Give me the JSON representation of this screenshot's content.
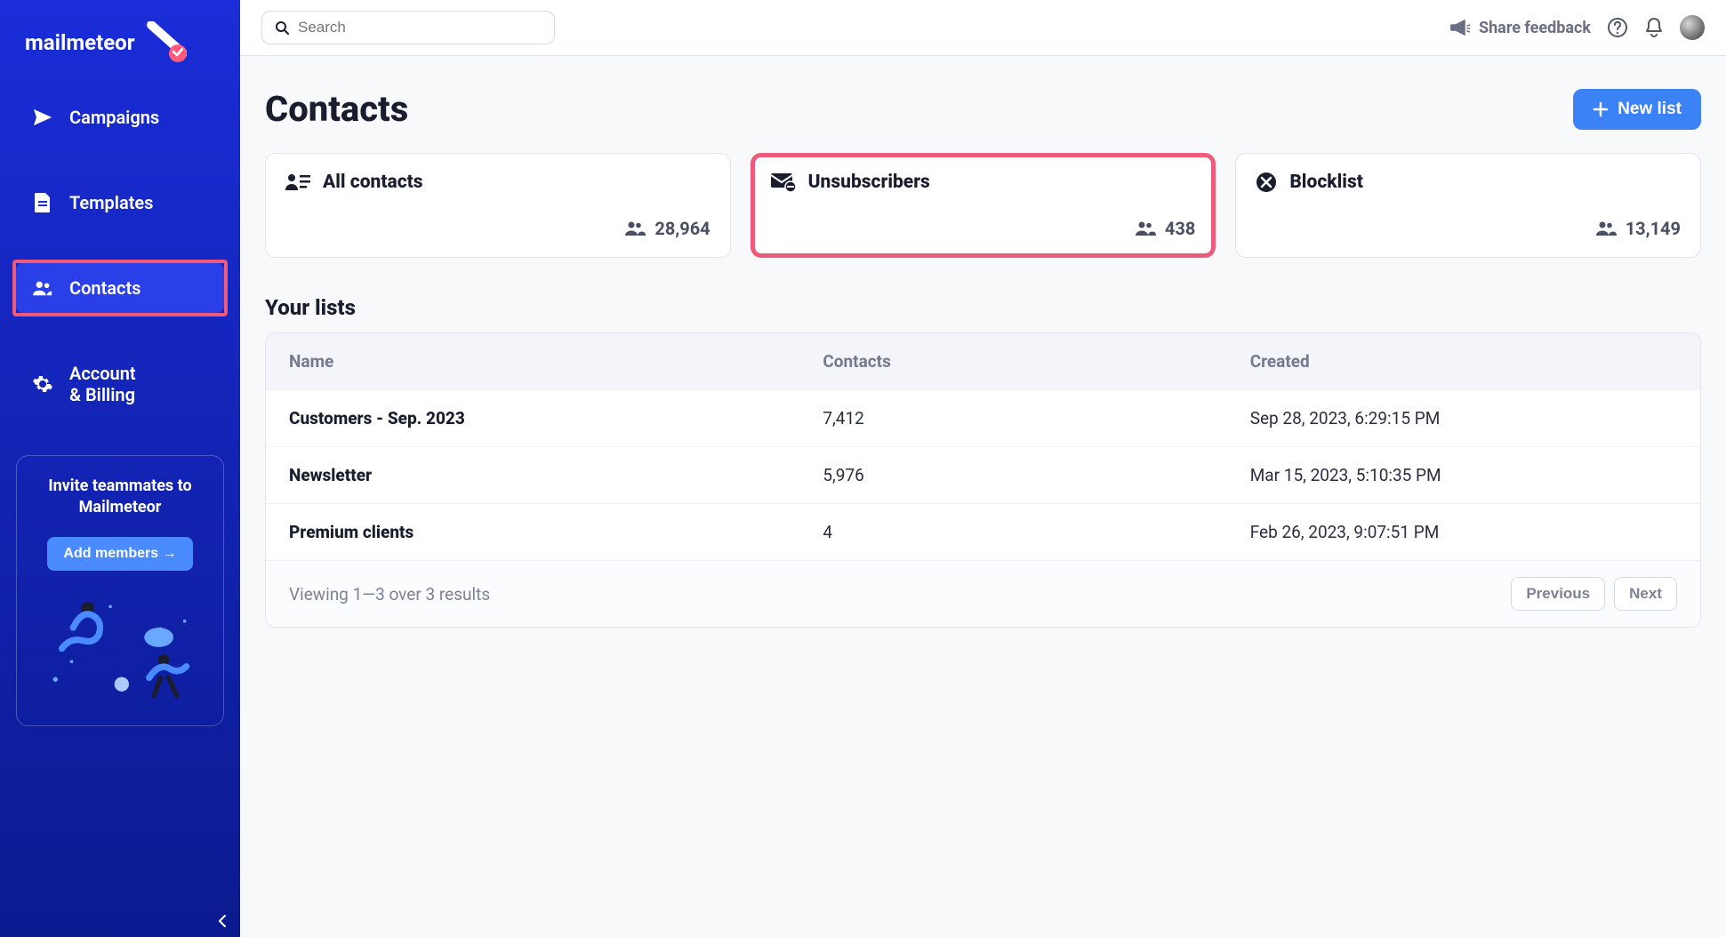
{
  "brand": {
    "name": "mailmeteor"
  },
  "sidebar": {
    "items": [
      {
        "label": "Campaigns"
      },
      {
        "label": "Templates"
      },
      {
        "label": "Contacts"
      },
      {
        "label": "Account\n& Billing"
      }
    ],
    "invite": {
      "title": "Invite teammates to Mailmeteor",
      "button": "Add members →"
    }
  },
  "topbar": {
    "search_placeholder": "Search",
    "share_feedback": "Share feedback"
  },
  "page": {
    "title": "Contacts",
    "new_list_button": "New list"
  },
  "cards": [
    {
      "title": "All contacts",
      "count": "28,964"
    },
    {
      "title": "Unsubscribers",
      "count": "438"
    },
    {
      "title": "Blocklist",
      "count": "13,149"
    }
  ],
  "lists": {
    "section_title": "Your lists",
    "columns": {
      "name": "Name",
      "contacts": "Contacts",
      "created": "Created"
    },
    "rows": [
      {
        "name": "Customers - Sep. 2023",
        "contacts": "7,412",
        "created": "Sep 28, 2023, 6:29:15 PM"
      },
      {
        "name": "Newsletter",
        "contacts": "5,976",
        "created": "Mar 15, 2023, 5:10:35 PM"
      },
      {
        "name": "Premium clients",
        "contacts": "4",
        "created": "Feb 26, 2023, 9:07:51 PM"
      }
    ],
    "footer_text": "Viewing 1—3 over 3 results",
    "prev": "Previous",
    "next": "Next"
  }
}
